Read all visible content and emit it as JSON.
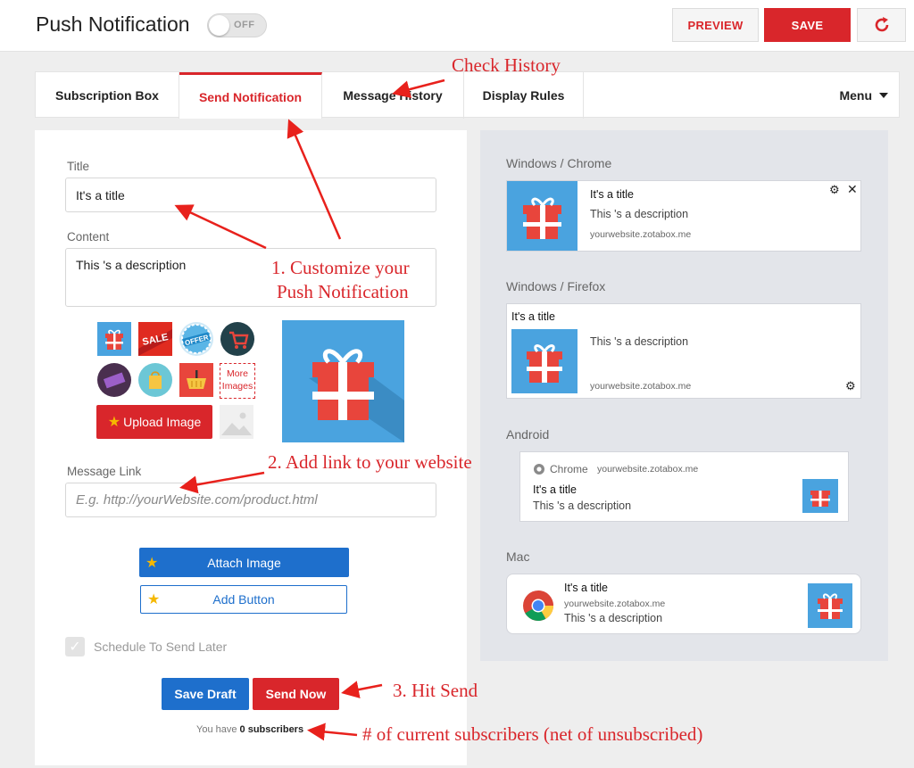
{
  "header": {
    "title": "Push Notification",
    "toggle_label": "OFF",
    "preview_label": "PREVIEW",
    "save_label": "SAVE"
  },
  "tabs": [
    {
      "label": "Subscription Box"
    },
    {
      "label": "Send Notification",
      "active": true
    },
    {
      "label": "Message History"
    },
    {
      "label": "Display Rules"
    }
  ],
  "menu_label": "Menu",
  "form": {
    "title_label": "Title",
    "title_value": "It's a title",
    "content_label": "Content",
    "content_value": "This 's a description",
    "more_images_label": "More Images",
    "upload_label": "Upload Image",
    "link_label": "Message Link",
    "link_placeholder": "E.g. http://yourWebsite.com/product.html",
    "attach_image_label": "Attach Image",
    "add_button_label": "Add Button",
    "schedule_label": "Schedule To Send Later",
    "save_draft_label": "Save Draft",
    "send_now_label": "Send Now",
    "subscribers_prefix": "You have",
    "subscribers_count": "0 subscribers"
  },
  "preview": {
    "windows_chrome": {
      "label": "Windows / Chrome",
      "title": "It's a title",
      "description": "This 's a description",
      "url": "yourwebsite.zotabox.me"
    },
    "windows_firefox": {
      "label": "Windows / Firefox",
      "title": "It's a title",
      "description": "This 's a description",
      "url": "yourwebsite.zotabox.me"
    },
    "android": {
      "label": "Android",
      "browser": "Chrome",
      "url": "yourwebsite.zotabox.me",
      "title": "It's a title",
      "description": "This 's a description"
    },
    "mac": {
      "label": "Mac",
      "title": "It's a title",
      "url": "yourwebsite.zotabox.me",
      "description": "This 's a description"
    }
  },
  "annotations": {
    "check_history": "Check History",
    "customize_line1": "1. Customize your",
    "customize_line2": "Push Notification",
    "add_link": "2. Add link to your website",
    "hit_send": "3. Hit Send",
    "subscribers_note": "# of current subscribers (net of unsubscribed)"
  },
  "colors": {
    "accent_red": "#d9262b",
    "accent_blue": "#1e6fcc",
    "gift_blue": "#4aa3df"
  },
  "icons": [
    "refresh-icon",
    "chevron-down-icon",
    "gear-icon",
    "close-icon",
    "star-icon",
    "chrome-icon",
    "gift-icon",
    "checkmark-icon"
  ]
}
